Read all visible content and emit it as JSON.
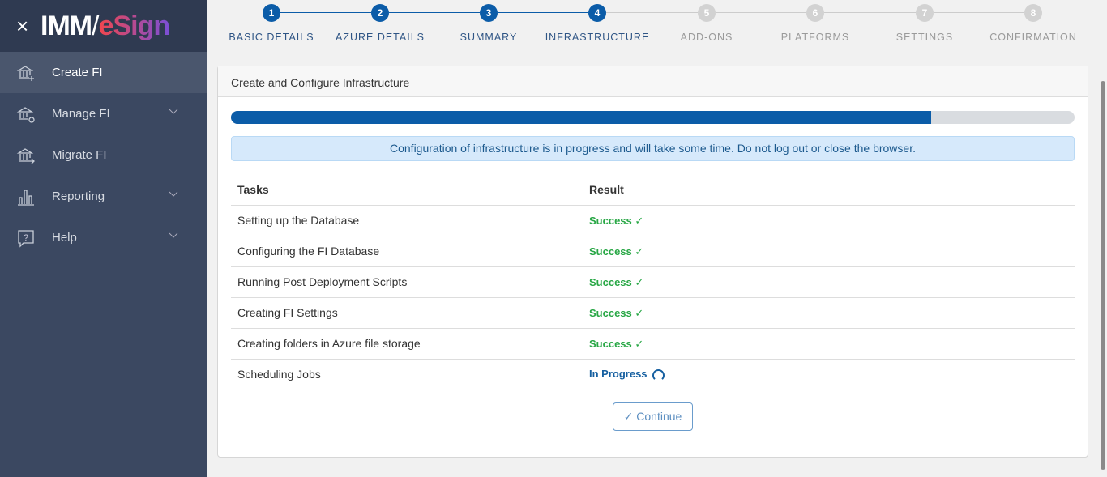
{
  "app": {
    "close_icon": "close-icon",
    "logo_text": "IMM/eSign"
  },
  "sidebar": {
    "items": [
      {
        "label": "Create FI",
        "icon": "bank-plus-icon",
        "active": true
      },
      {
        "label": "Manage FI",
        "icon": "bank-gear-icon",
        "expandable": true
      },
      {
        "label": "Migrate FI",
        "icon": "bank-arrow-icon"
      },
      {
        "label": "Reporting",
        "icon": "bar-chart-icon",
        "expandable": true
      },
      {
        "label": "Help",
        "icon": "help-bubble-icon",
        "expandable": true
      }
    ]
  },
  "stepper": {
    "current": 4,
    "steps": [
      {
        "num": "1",
        "label": "BASIC DETAILS"
      },
      {
        "num": "2",
        "label": "AZURE DETAILS"
      },
      {
        "num": "3",
        "label": "SUMMARY"
      },
      {
        "num": "4",
        "label": "INFRASTRUCTURE"
      },
      {
        "num": "5",
        "label": "ADD-ONS"
      },
      {
        "num": "6",
        "label": "PLATFORMS"
      },
      {
        "num": "7",
        "label": "SETTINGS"
      },
      {
        "num": "8",
        "label": "CONFIRMATION"
      }
    ]
  },
  "card": {
    "title": "Create and Configure Infrastructure",
    "progress_percent": 83,
    "alert": "Configuration of infrastructure is in progress and will take some time. Do not log out or close the browser.",
    "columns": {
      "tasks": "Tasks",
      "result": "Result"
    },
    "rows": [
      {
        "task": "Setting up the Database",
        "result": "Success",
        "status": "success"
      },
      {
        "task": "Configuring the FI Database",
        "result": "Success",
        "status": "success"
      },
      {
        "task": "Running Post Deployment Scripts",
        "result": "Success",
        "status": "success"
      },
      {
        "task": "Creating FI Settings",
        "result": "Success",
        "status": "success"
      },
      {
        "task": "Creating folders in Azure file storage",
        "result": "Success",
        "status": "success"
      },
      {
        "task": "Scheduling Jobs",
        "result": "In Progress",
        "status": "in-progress"
      }
    ],
    "continue_label": "Continue"
  },
  "colors": {
    "primary": "#0b5ca8",
    "success": "#28a745",
    "sidebar": "#3b4861"
  }
}
